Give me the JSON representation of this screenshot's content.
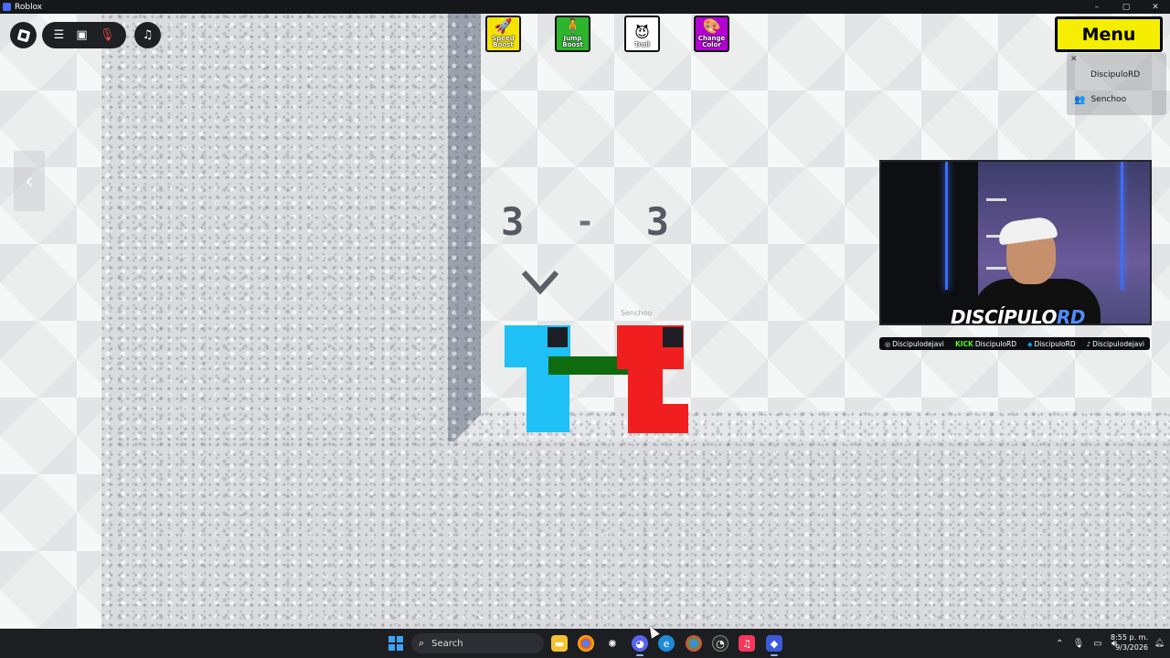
{
  "window": {
    "title": "Roblox",
    "controls": [
      "–",
      "▢",
      "✕"
    ]
  },
  "roblox_controls": {
    "menu_icon": "hamburger-icon",
    "chat_icon": "chat-icon",
    "mic_icon": "mic-muted-icon",
    "music_icon": "music-note-icon"
  },
  "powerups": [
    {
      "label": "Speed Boost",
      "icon": "rocket-icon",
      "color": "#f2e400"
    },
    {
      "label": "Jump Boost",
      "icon": "person-jump-icon",
      "color": "#2db52d"
    },
    {
      "label": "Troll",
      "icon": "devil-face-icon",
      "color": "#ffffff"
    },
    {
      "label": "Change Color",
      "icon": "color-wheel-icon",
      "color": "#b400d4"
    }
  ],
  "menu": {
    "label": "Menu",
    "color": "#f5ee00"
  },
  "player_list": {
    "players": [
      "DiscipuloRD",
      "Senchoo"
    ]
  },
  "score": {
    "left": "3",
    "separator": "-",
    "right": "3"
  },
  "nametag": "Senchoo",
  "characters": [
    {
      "name": "blue-character",
      "color": "#1ec0f5"
    },
    {
      "name": "red-character",
      "color": "#f01e1e"
    }
  ],
  "bar_color": "#0e6b0e",
  "webcam": {
    "brand_main": "DISCÍPULO",
    "brand_accent": "RD",
    "socials": [
      {
        "icon": "instagram-icon",
        "prefix": "",
        "handle": "Discipulodejavi"
      },
      {
        "icon": "kick-icon",
        "prefix": "KICK",
        "handle": "DiscipuloRD"
      },
      {
        "icon": "twitter-icon",
        "prefix": "",
        "handle": "DiscipuloRD"
      },
      {
        "icon": "tiktok-icon",
        "prefix": "",
        "handle": "Discipulodejavi"
      }
    ]
  },
  "taskbar": {
    "search_placeholder": "Search",
    "apps": [
      "file-explorer-icon",
      "chrome-icon",
      "chatgpt-icon",
      "discord-icon",
      "edge-icon",
      "chrome-alt-icon",
      "obs-icon",
      "itunes-icon",
      "roblox-icon"
    ],
    "time": "8:55 p. m.",
    "date": "9/3/2026"
  }
}
